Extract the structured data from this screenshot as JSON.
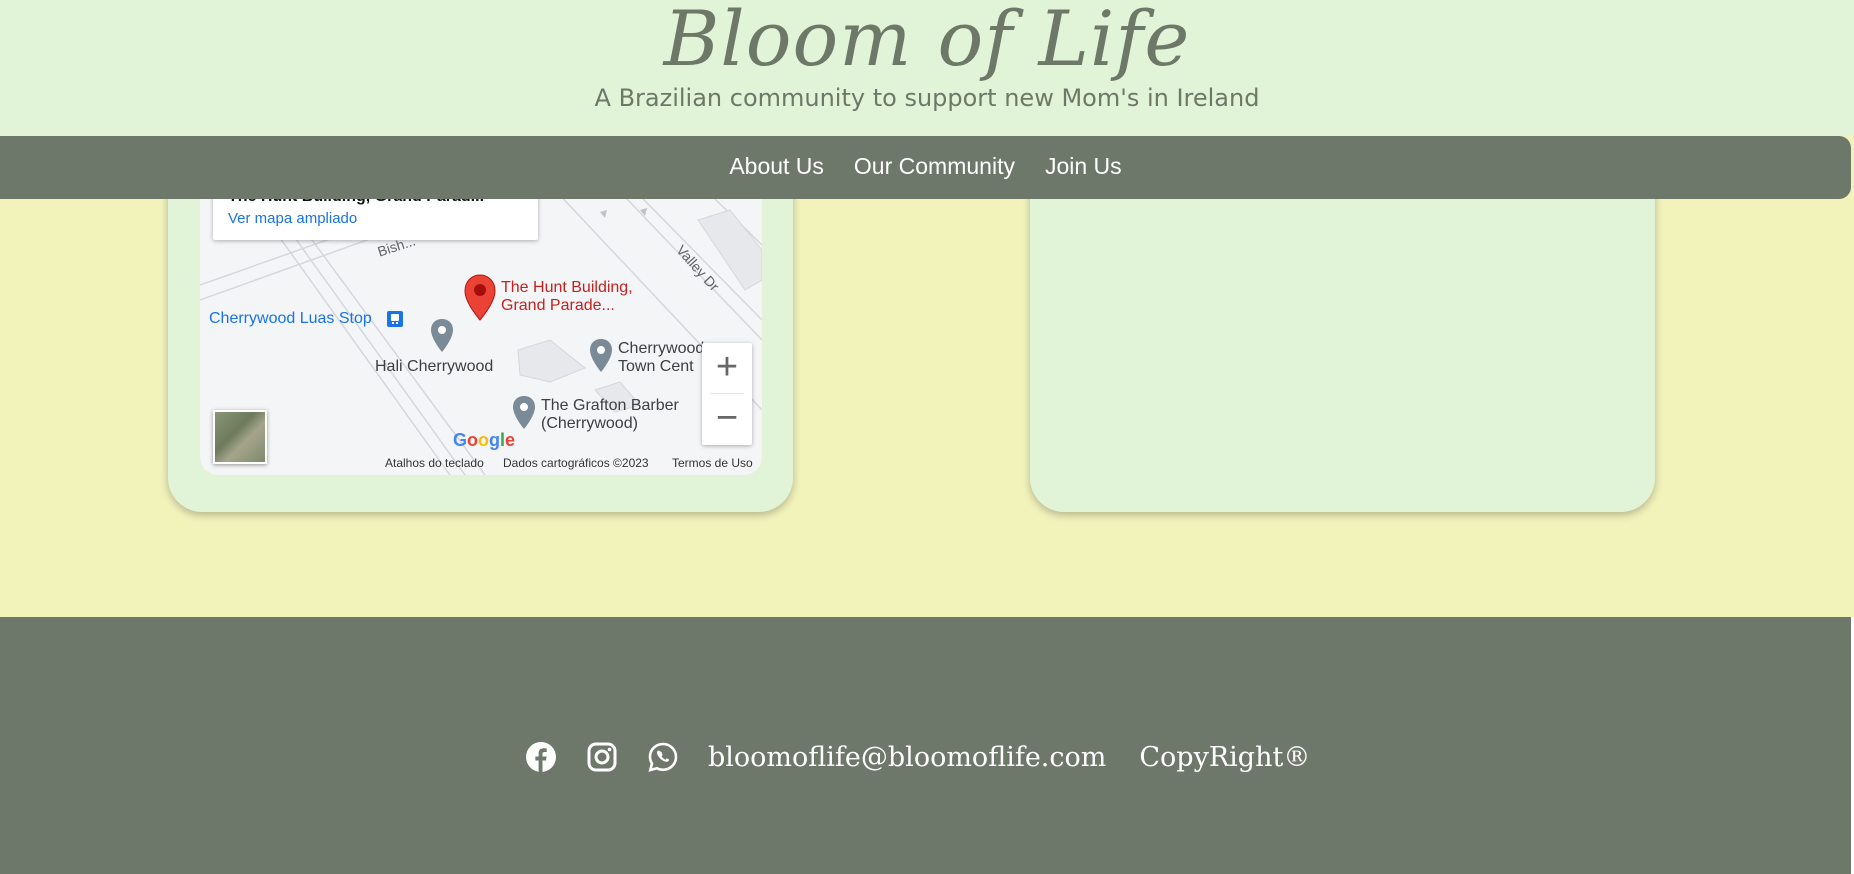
{
  "header": {
    "brand": "Bloom of Life",
    "tagline": "A Brazilian community to support new Mom's in Ireland"
  },
  "nav": {
    "items": [
      {
        "label": "About Us"
      },
      {
        "label": "Our Community"
      },
      {
        "label": "Join Us"
      }
    ]
  },
  "map": {
    "infobox_title": "The Hunt Building, Grand Parad...",
    "infobox_link": "Ver mapa ampliado",
    "streets": [
      "Bish...",
      "Valley Dr"
    ],
    "places": {
      "pin_label_line1": "The Hunt Building,",
      "pin_label_line2": "Grand Parade...",
      "luas": "Cherrywood Luas Stop",
      "hali": "Hali Cherrywood",
      "town_line1": "Cherrywood",
      "town_line2": "Town Cent",
      "barber_line1": "The Grafton Barber",
      "barber_line2": "(Cherrywood)"
    },
    "zoom_in": "+",
    "zoom_out": "−",
    "logo": "Google",
    "attr": {
      "shortcuts": "Atalhos do teclado",
      "data": "Dados cartográficos ©2023",
      "terms": "Termos de Uso"
    }
  },
  "footer": {
    "icons": [
      "facebook-icon",
      "instagram-icon",
      "whatsapp-icon"
    ],
    "email": "bloomoflife@bloomoflife.com",
    "copyright": "CopyRight®"
  },
  "colors": {
    "header_bg": "#e1f4d8",
    "nav_bg": "#6e786a",
    "main_bg": "#f2f2bb",
    "card_bg": "#e1f4d8",
    "footer_bg": "#6e786a",
    "pin_red": "#ea4335",
    "link_blue": "#1a73e8"
  }
}
